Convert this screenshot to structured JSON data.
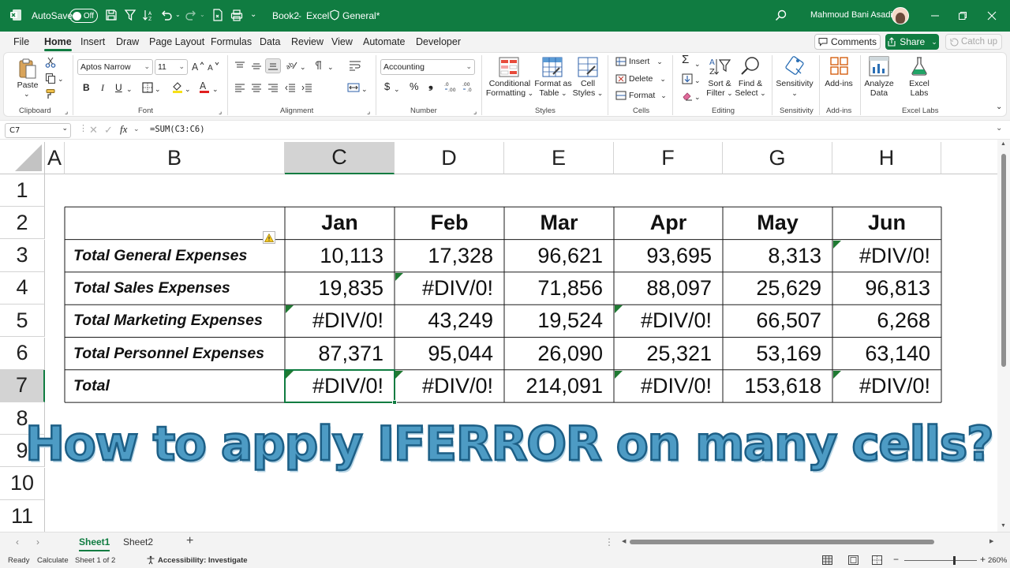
{
  "titlebar": {
    "autosave_label": "AutoSave",
    "autosave_state": "Off",
    "filename": "Book2",
    "app": "Excel",
    "sensitivity": "General*",
    "user": "Mahmoud Bani Asadi"
  },
  "menu": {
    "tabs": [
      "File",
      "Home",
      "Insert",
      "Draw",
      "Page Layout",
      "Formulas",
      "Data",
      "Review",
      "View",
      "Automate",
      "Developer"
    ],
    "active": "Home",
    "comments": "Comments",
    "share": "Share",
    "catchup": "Catch up"
  },
  "ribbon": {
    "paste": "Paste",
    "font_name": "Aptos Narrow",
    "font_size": "11",
    "number_format": "Accounting",
    "conditional_formatting": [
      "Conditional",
      "Formatting"
    ],
    "format_as_table": [
      "Format as",
      "Table"
    ],
    "cell_styles": [
      "Cell",
      "Styles"
    ],
    "insert": "Insert",
    "delete": "Delete",
    "format": "Format",
    "sort_filter": [
      "Sort &",
      "Filter"
    ],
    "find_select": [
      "Find &",
      "Select"
    ],
    "sensitivity": "Sensitivity",
    "addins": [
      "Add-ins"
    ],
    "analyze_data": [
      "Analyze",
      "Data"
    ],
    "excel_labs": [
      "Excel",
      "Labs"
    ],
    "groups": {
      "clipboard": "Clipboard",
      "font": "Font",
      "alignment": "Alignment",
      "number": "Number",
      "styles": "Styles",
      "cells": "Cells",
      "editing": "Editing",
      "sensitivity": "Sensitivity",
      "addins": "Add-ins",
      "excel_labs": "Excel Labs"
    }
  },
  "formula_bar": {
    "name_box": "C7",
    "formula": "=SUM(C3:C6)"
  },
  "sheet": {
    "columns": [
      "A",
      "B",
      "C",
      "D",
      "E",
      "F",
      "G",
      "H"
    ],
    "rows": [
      "1",
      "2",
      "3",
      "4",
      "5",
      "6",
      "7",
      "8",
      "9",
      "10",
      "11"
    ],
    "selected_cell": "C7",
    "table_headers": [
      "Jan",
      "Feb",
      "Mar",
      "Apr",
      "May",
      "Jun"
    ],
    "table_rows": [
      {
        "label": "Total General Expenses",
        "values": [
          "10,113",
          "17,328",
          "96,621",
          "93,695",
          "8,313",
          "#DIV/0!"
        ]
      },
      {
        "label": "Total Sales Expenses",
        "values": [
          "19,835",
          "#DIV/0!",
          "71,856",
          "88,097",
          "25,629",
          "96,813"
        ]
      },
      {
        "label": "Total Marketing Expenses",
        "values": [
          "#DIV/0!",
          "43,249",
          "19,524",
          "#DIV/0!",
          "66,507",
          "6,268"
        ]
      },
      {
        "label": "Total Personnel Expenses",
        "values": [
          "87,371",
          "95,044",
          "26,090",
          "25,321",
          "53,169",
          "63,140"
        ]
      },
      {
        "label": "Total",
        "values": [
          "#DIV/0!",
          "#DIV/0!",
          "214,091",
          "#DIV/0!",
          "153,618",
          "#DIV/0!"
        ]
      }
    ],
    "headline": "How to apply IFERROR on many cells?"
  },
  "sheet_tabs": {
    "tabs": [
      "Sheet1",
      "Sheet2"
    ],
    "active": "Sheet1"
  },
  "status": {
    "ready": "Ready",
    "calculate": "Calculate",
    "sheet_of": "Sheet 1 of 2",
    "accessibility": "Accessibility: Investigate",
    "zoom": "260%"
  },
  "colors": {
    "brand": "#107c41",
    "error_indicator": "#1f7a32",
    "headline_fill": "#4d9bc4",
    "headline_stroke": "#1d5f86"
  }
}
